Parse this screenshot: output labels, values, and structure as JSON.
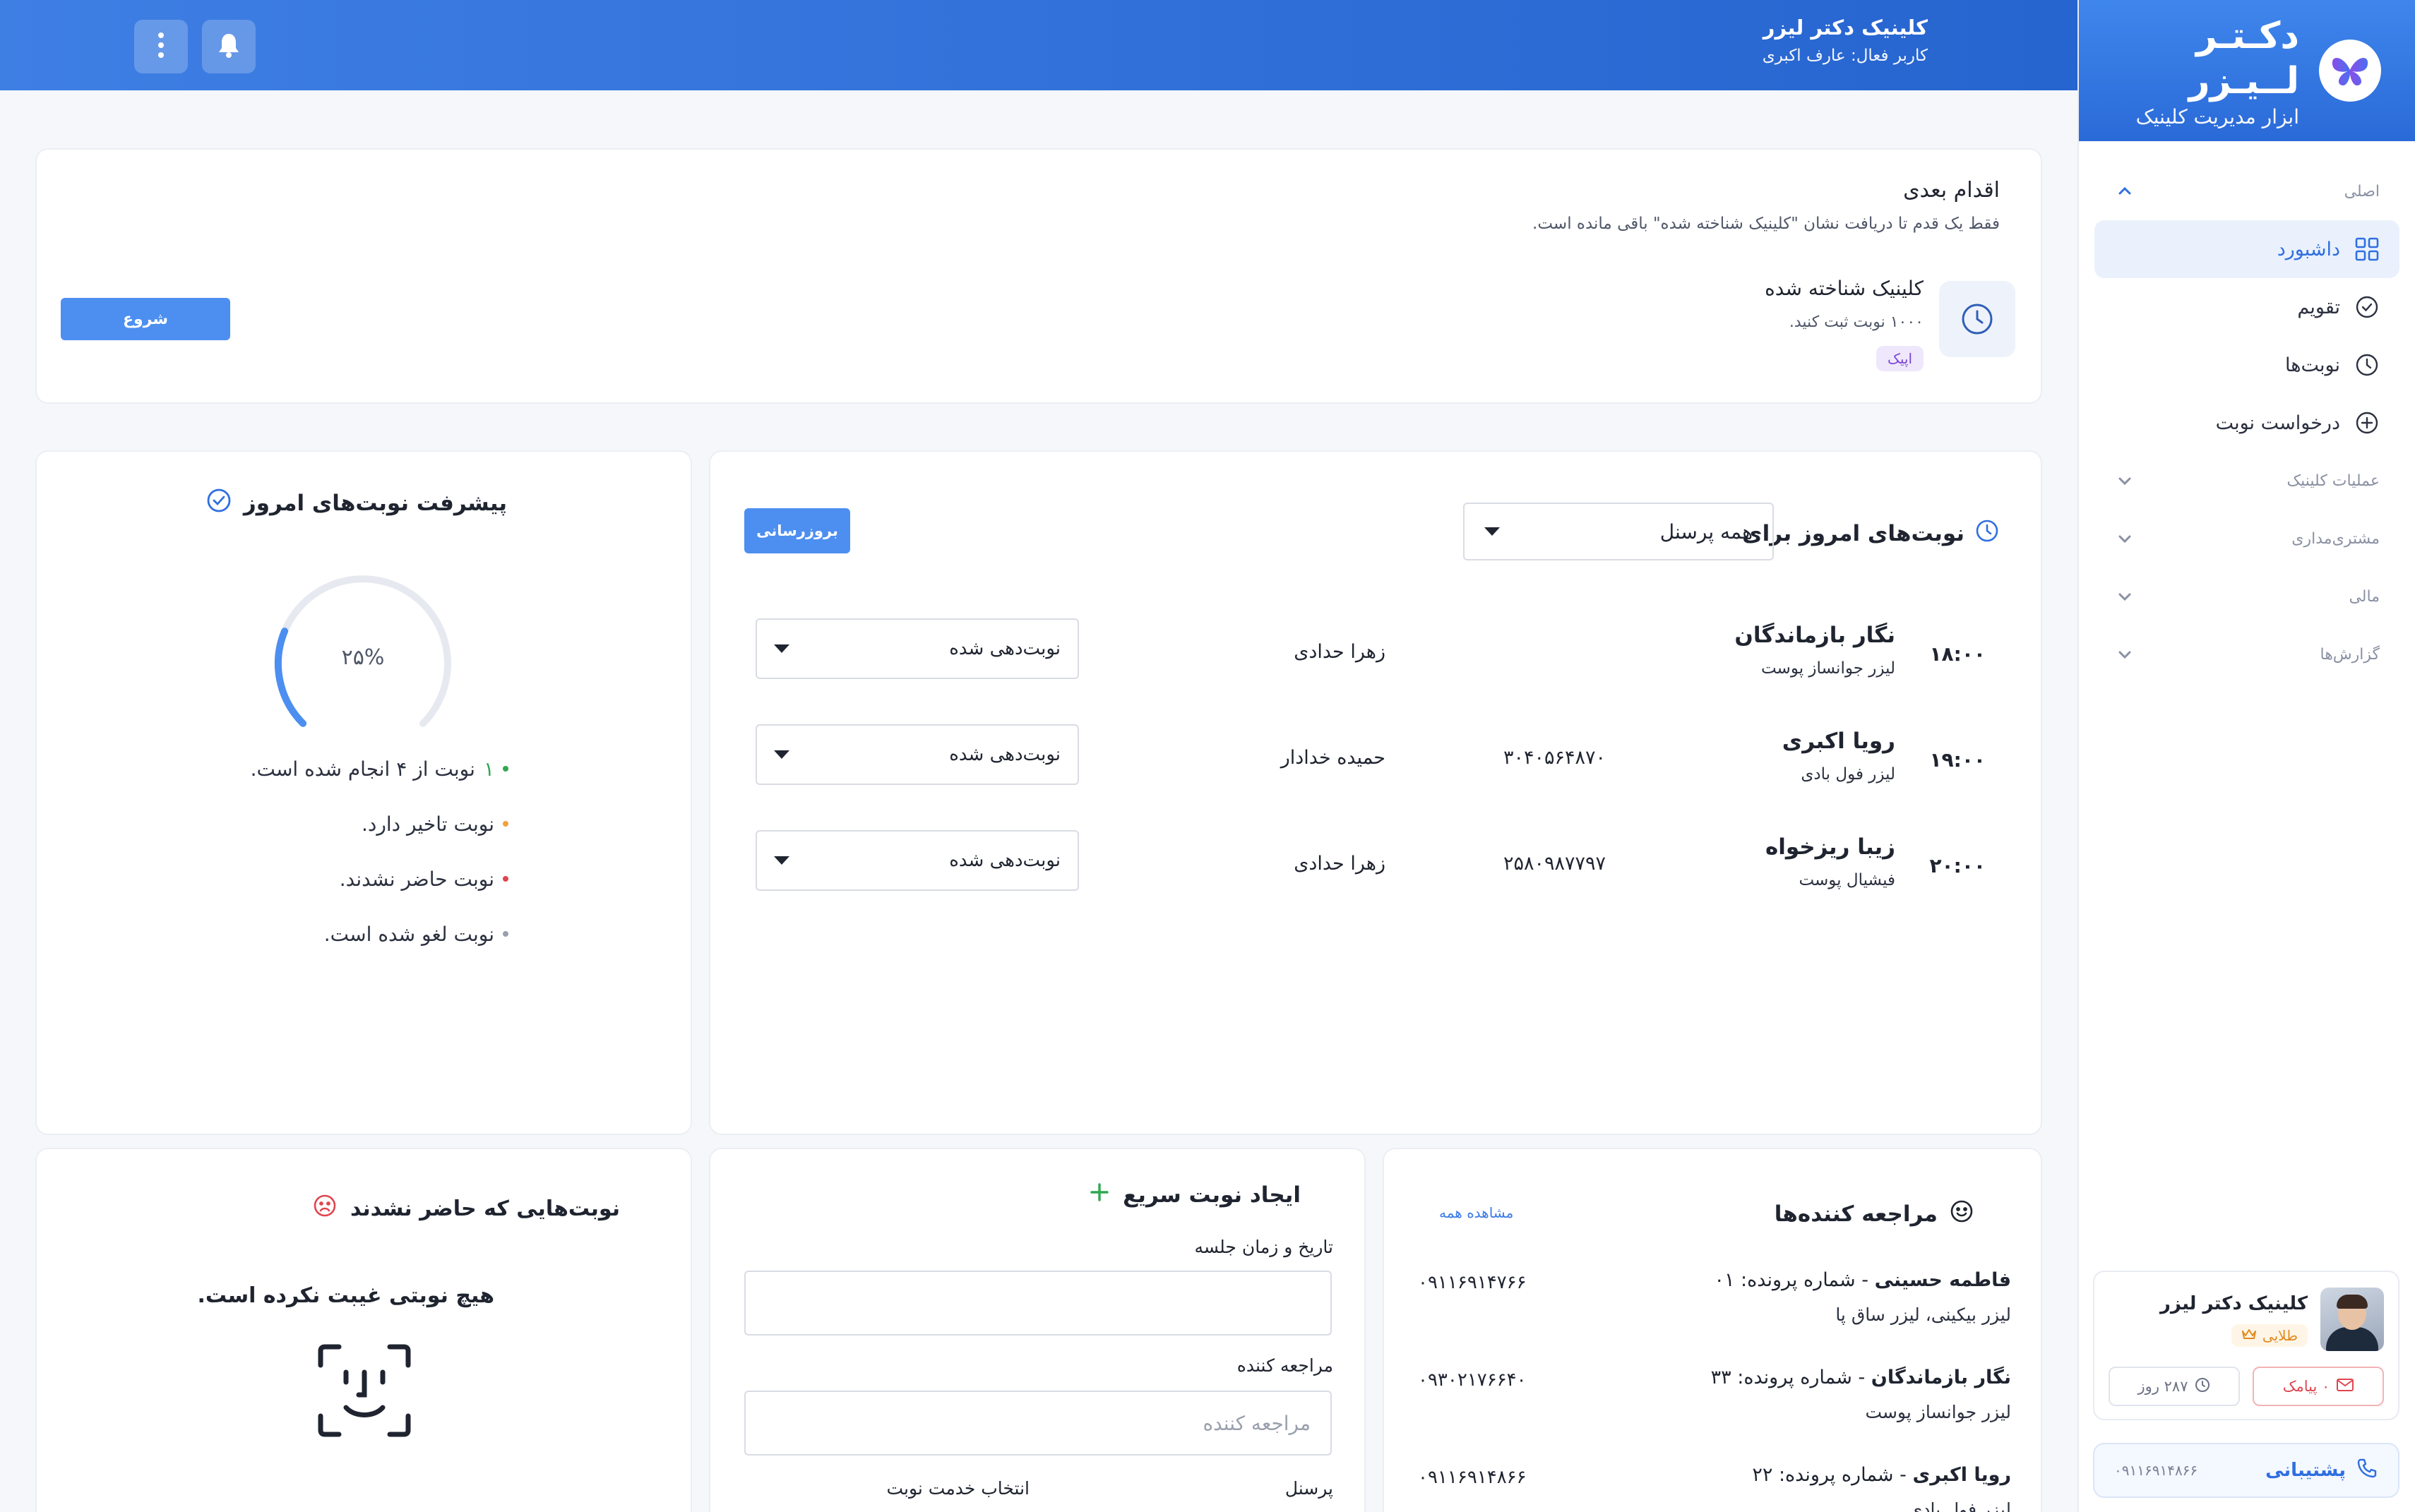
{
  "brand": {
    "title": "دکـتـر لــیـزر",
    "subtitle": "ابزار مدیریت کلینیک"
  },
  "header": {
    "clinic_name": "کلینیک دکتر لیزر",
    "active_user": "کاربر فعال: عارف اکبری"
  },
  "sidebar": {
    "main_section": "اصلی",
    "items": [
      {
        "label": "داشبورد",
        "icon": "dashboard-icon"
      },
      {
        "label": "تقویم",
        "icon": "check-circle-icon"
      },
      {
        "label": "نوبت‌ها",
        "icon": "clock-icon"
      },
      {
        "label": "درخواست نوبت",
        "icon": "plus-circle-icon"
      }
    ],
    "sections": [
      "عملیات کلینیک",
      "مشتری‌مداری",
      "مالی",
      "گزارش‌ها"
    ],
    "profile": {
      "name": "کلینیک دکتر لیزر",
      "tier": "طلایی",
      "sms": "۰ پیامک",
      "days": "۲۸۷ روز"
    },
    "support": {
      "label": "پشتیبانی",
      "phone": "۰۹۱۱۶۹۱۴۸۶۶"
    }
  },
  "next_step": {
    "title": "اقدام بعدی",
    "description": "فقط یک قدم تا دریافت نشان \"کلینیک شناخته شده\" باقی مانده است.",
    "achievement_title": "کلینیک شناخته شده",
    "achievement_desc": "۱۰۰۰ نوبت ثبت کنید.",
    "badge": "اپیک",
    "start_button": "شروع"
  },
  "progress": {
    "title": "پیشرفت نوبت‌های امروز",
    "percent_label": "۲۵%",
    "percent": 25,
    "lines": [
      {
        "count": "۱",
        "text": "نوبت از ۴ انجام شده است.",
        "color": "#2fa84f"
      },
      {
        "count": "",
        "text": "نوبت تاخیر دارد.",
        "color": "#f0a33a"
      },
      {
        "count": "",
        "text": "نوبت حاضر نشدند.",
        "color": "#e04650"
      },
      {
        "count": "",
        "text": "نوبت لغو شده است.",
        "color": "#9aa0ad"
      }
    ]
  },
  "appointments": {
    "title": "نوبت‌های امروز برای",
    "staff_filter": "همه پرسنل",
    "refresh_button": "بروزرسانی",
    "rows": [
      {
        "time": "۱۸:۰۰",
        "name": "نگار بازماندگان",
        "service": "لیزر جوانساز پوست",
        "phone": "",
        "staff": "زهرا حدادی",
        "status": "نوبت‌دهی شده"
      },
      {
        "time": "۱۹:۰۰",
        "name": "رویا اکبری",
        "service": "لیزر فول بادی",
        "phone": "۳۰۴۰۵۶۴۸۷۰",
        "staff": "حمیده خدادار",
        "status": "نوبت‌دهی شده"
      },
      {
        "time": "۲۰:۰۰",
        "name": "زیبا ریزخواه",
        "service": "فیشیال پوست",
        "phone": "۲۵۸۰۹۸۷۷۹۷",
        "staff": "زهرا حدادی",
        "status": "نوبت‌دهی شده"
      }
    ]
  },
  "no_show": {
    "title": "نوبت‌هایی که حاضر نشدند",
    "message": "هیچ نوبتی غیبت نکرده است."
  },
  "quick_booking": {
    "title": "ایجاد نوبت سریع",
    "datetime_label": "تاریخ و زمان جلسه",
    "client_label": "مراجعه کننده",
    "client_placeholder": "مراجعه کننده",
    "staff_label": "پرسنل",
    "service_label": "انتخاب خدمت نوبت"
  },
  "clients": {
    "title": "مراجعه کننده‌ها",
    "see_all": "مشاهده همه",
    "rows": [
      {
        "name": "فاطمه حسینی",
        "file": " - شماره پرونده: ۰۱",
        "services": "لیزر بیکینی، لیزر ساق پا",
        "phone": "۰۹۱۱۶۹۱۴۷۶۶"
      },
      {
        "name": "نگار بازماندگان",
        "file": " - شماره پرونده: ۳۳",
        "services": "لیزر جوانساز پوست",
        "phone": "۰۹۳۰۲۱۷۶۶۴۰"
      },
      {
        "name": "رویا اکبری",
        "file": " - شماره پرونده: ۲۲",
        "services": "لیزر فول بادی",
        "phone": "۰۹۱۱۶۹۱۴۸۶۶"
      }
    ]
  }
}
